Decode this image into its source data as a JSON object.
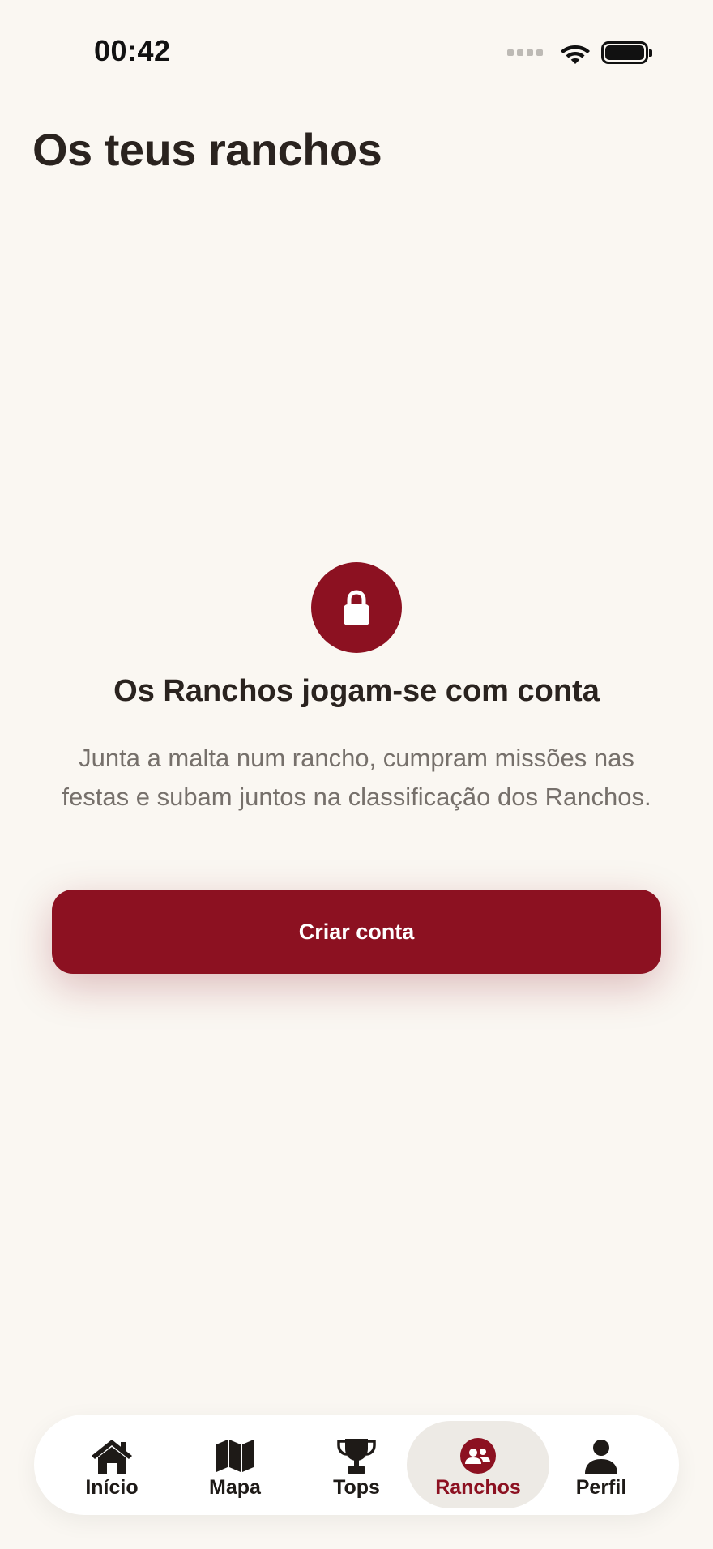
{
  "status_bar": {
    "time": "00:42"
  },
  "header": {
    "title": "Os teus ranchos"
  },
  "empty_state": {
    "icon": "lock-icon",
    "title": "Os Ranchos jogam-se com conta",
    "description": "Junta a malta num rancho, cumpram missões nas festas e subam juntos na classificação dos Ranchos.",
    "cta_label": "Criar conta"
  },
  "tabs": [
    {
      "label": "Início",
      "icon": "home-icon",
      "active": false
    },
    {
      "label": "Mapa",
      "icon": "map-icon",
      "active": false
    },
    {
      "label": "Tops",
      "icon": "trophy-icon",
      "active": false
    },
    {
      "label": "Ranchos",
      "icon": "group-icon",
      "active": true
    },
    {
      "label": "Perfil",
      "icon": "person-icon",
      "active": false
    }
  ],
  "colors": {
    "accent": "#8C1121",
    "background": "#FAF7F2",
    "text_primary": "#2A231F",
    "text_secondary": "#76706B",
    "active_tab_bg": "#EDEAE5"
  }
}
